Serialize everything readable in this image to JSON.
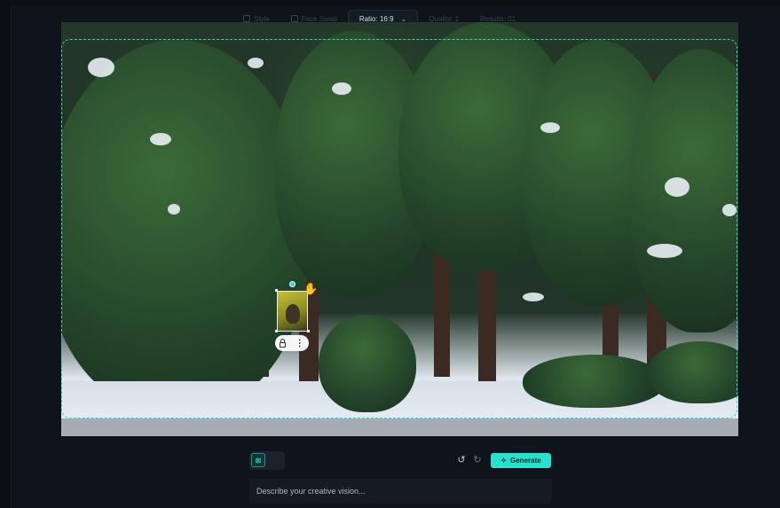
{
  "toolbar": {
    "items": [
      {
        "label": "Style",
        "active": false
      },
      {
        "label": "Face Swap",
        "active": false
      },
      {
        "label": "Ratio: 16:9",
        "active": true
      },
      {
        "label": "Quality: 1",
        "active": false
      },
      {
        "label": "Results: 01",
        "active": false
      }
    ]
  },
  "canvas": {
    "selection_color": "#33d6c9"
  },
  "layer_controls": {
    "lock_icon": "lock-icon",
    "more_icon": "more-vertical-icon",
    "more_glyph": "⋮"
  },
  "actions": {
    "undo_glyph": "↺",
    "redo_glyph": "↻",
    "generate_label": "Generate",
    "generate_icon": "✧",
    "accent": "#26e2cf"
  },
  "prompt": {
    "placeholder": "Describe your creative vision..."
  }
}
